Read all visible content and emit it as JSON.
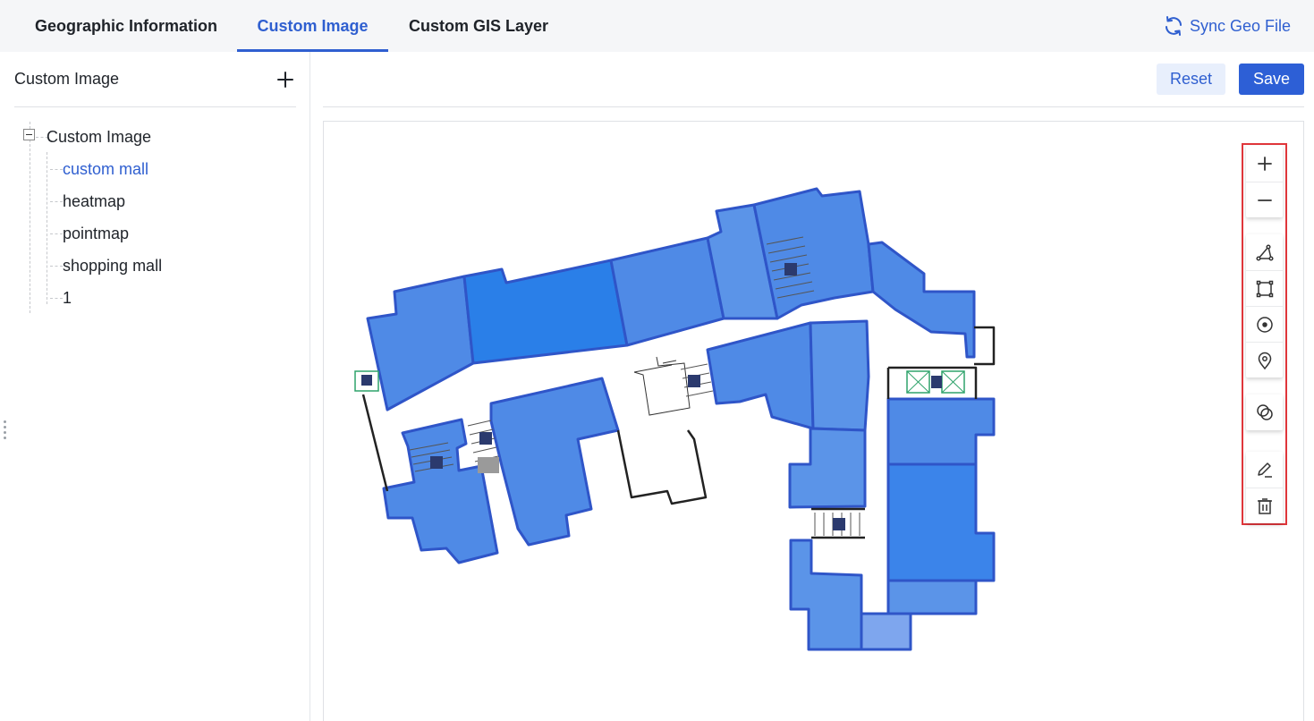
{
  "tabs": [
    {
      "label": "Geographic Information",
      "active": false
    },
    {
      "label": "Custom Image",
      "active": true
    },
    {
      "label": "Custom GIS Layer",
      "active": false
    }
  ],
  "sync": {
    "label": "Sync Geo File",
    "icon": "refresh-icon"
  },
  "sidebar": {
    "title": "Custom Image",
    "add_icon": "plus-icon",
    "tree": {
      "root": "Custom Image",
      "children": [
        "custom mall",
        "heatmap",
        "pointmap",
        "shopping mall",
        "1"
      ],
      "selected": "custom mall"
    }
  },
  "actions": {
    "reset_label": "Reset",
    "save_label": "Save"
  },
  "map": {
    "tools": [
      "zoom-in-icon",
      "zoom-out-icon",
      "polyline-icon",
      "rectangle-icon",
      "circle-icon",
      "marker-icon",
      "overlap-icon",
      "edit-icon",
      "delete-icon"
    ]
  },
  "colors": {
    "accent": "#2f5fd0",
    "room": "#4f8ae6",
    "room_dark": "#2a7fe8",
    "outline": "#2f55c8",
    "highlight": "#e0363b"
  }
}
